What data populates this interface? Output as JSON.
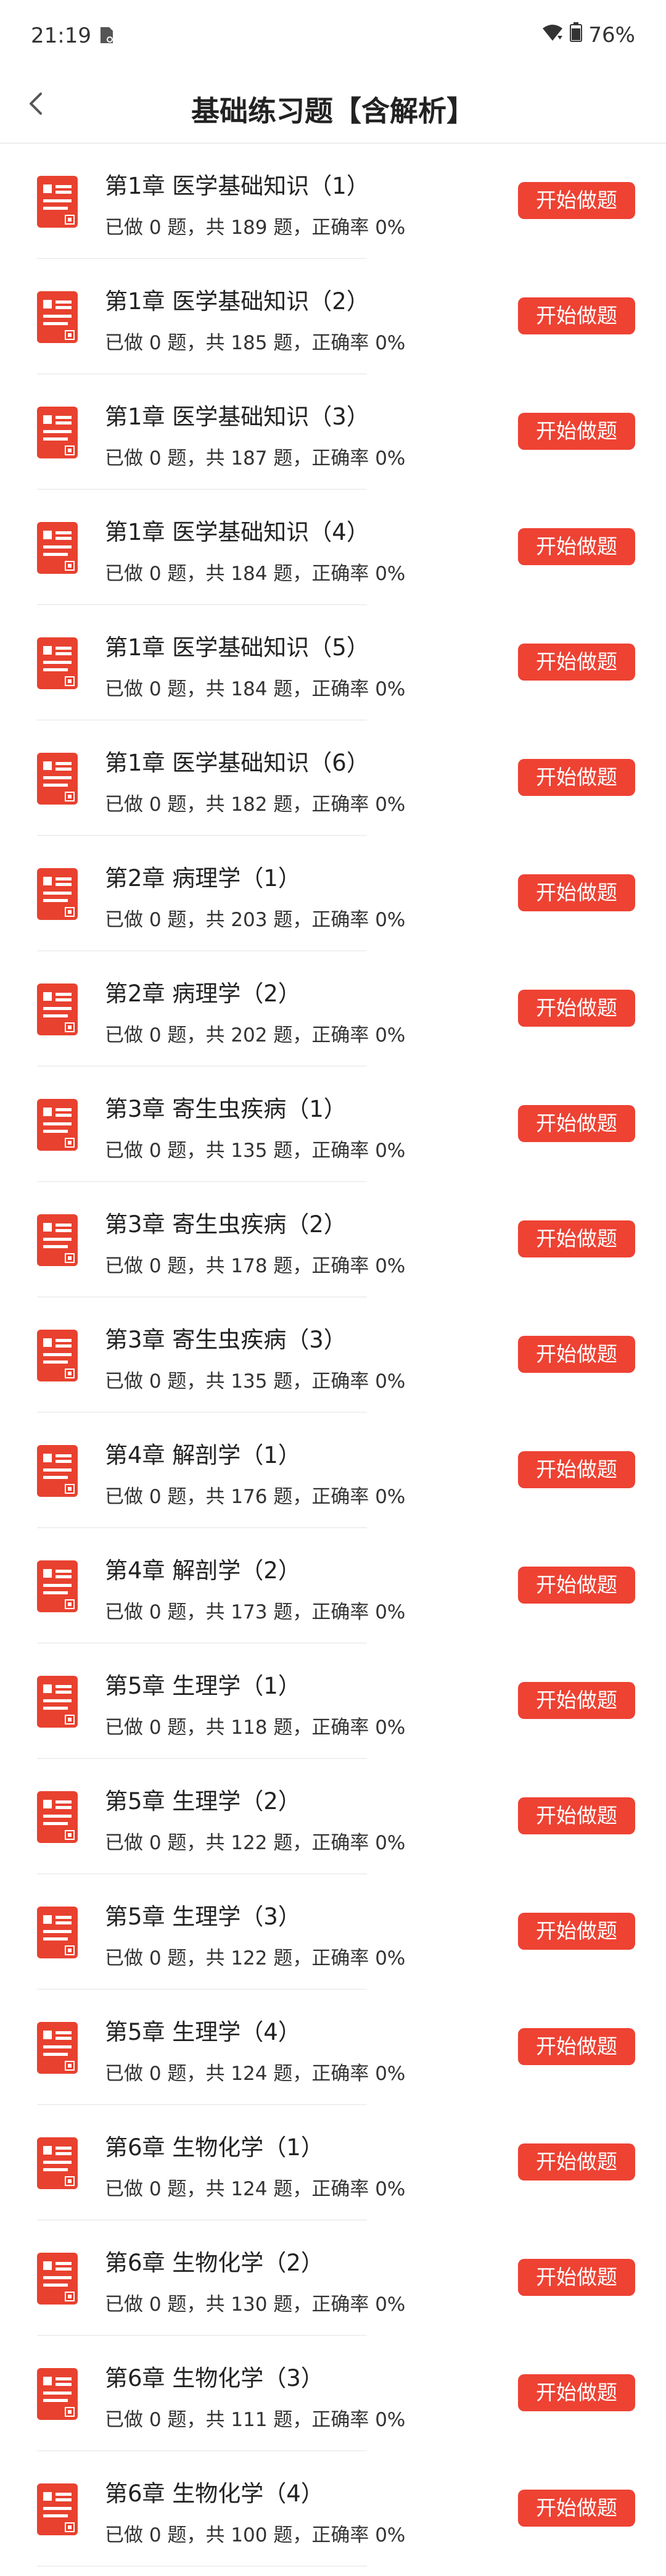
{
  "status_bar": {
    "time": "21:19",
    "battery": "76%"
  },
  "header": {
    "title": "基础练习题【含解析】"
  },
  "labels": {
    "done_prefix": "已做 ",
    "done_suffix": " 题，共 ",
    "total_suffix": " 题，正确率 ",
    "start_button": "开始做题"
  },
  "colors": {
    "accent": "#ee4233"
  },
  "items": [
    {
      "title": "第1章 医学基础知识（1）",
      "done": "0",
      "total": "189",
      "rate": "0%"
    },
    {
      "title": "第1章 医学基础知识（2）",
      "done": "0",
      "total": "185",
      "rate": "0%"
    },
    {
      "title": "第1章 医学基础知识（3）",
      "done": "0",
      "total": "187",
      "rate": "0%"
    },
    {
      "title": "第1章 医学基础知识（4）",
      "done": "0",
      "total": "184",
      "rate": "0%"
    },
    {
      "title": "第1章 医学基础知识（5）",
      "done": "0",
      "total": "184",
      "rate": "0%"
    },
    {
      "title": "第1章 医学基础知识（6）",
      "done": "0",
      "total": "182",
      "rate": "0%"
    },
    {
      "title": "第2章 病理学（1）",
      "done": "0",
      "total": "203",
      "rate": "0%"
    },
    {
      "title": "第2章 病理学（2）",
      "done": "0",
      "total": "202",
      "rate": "0%"
    },
    {
      "title": "第3章 寄生虫疾病（1）",
      "done": "0",
      "total": "135",
      "rate": "0%"
    },
    {
      "title": "第3章 寄生虫疾病（2）",
      "done": "0",
      "total": "178",
      "rate": "0%"
    },
    {
      "title": "第3章 寄生虫疾病（3）",
      "done": "0",
      "total": "135",
      "rate": "0%"
    },
    {
      "title": "第4章 解剖学（1）",
      "done": "0",
      "total": "176",
      "rate": "0%"
    },
    {
      "title": "第4章 解剖学（2）",
      "done": "0",
      "total": "173",
      "rate": "0%"
    },
    {
      "title": "第5章 生理学（1）",
      "done": "0",
      "total": "118",
      "rate": "0%"
    },
    {
      "title": "第5章 生理学（2）",
      "done": "0",
      "total": "122",
      "rate": "0%"
    },
    {
      "title": "第5章 生理学（3）",
      "done": "0",
      "total": "122",
      "rate": "0%"
    },
    {
      "title": "第5章 生理学（4）",
      "done": "0",
      "total": "124",
      "rate": "0%"
    },
    {
      "title": "第6章 生物化学（1）",
      "done": "0",
      "total": "124",
      "rate": "0%"
    },
    {
      "title": "第6章 生物化学（2）",
      "done": "0",
      "total": "130",
      "rate": "0%"
    },
    {
      "title": "第6章 生物化学（3）",
      "done": "0",
      "total": "111",
      "rate": "0%"
    },
    {
      "title": "第6章 生物化学（4）",
      "done": "0",
      "total": "100",
      "rate": "0%"
    }
  ]
}
